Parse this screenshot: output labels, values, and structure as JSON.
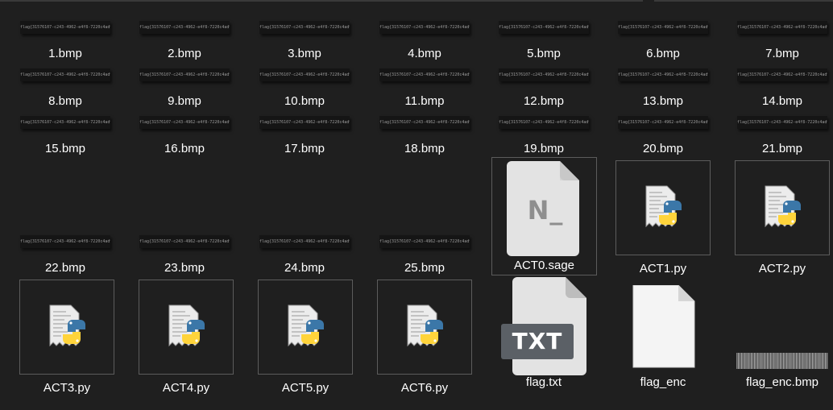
{
  "strip_text": "flag{31576107-c243-4962-e4f8-7220c4ad9a76}",
  "files": [
    {
      "name": "1.bmp"
    },
    {
      "name": "2.bmp"
    },
    {
      "name": "3.bmp"
    },
    {
      "name": "4.bmp"
    },
    {
      "name": "5.bmp"
    },
    {
      "name": "6.bmp"
    },
    {
      "name": "7.bmp"
    },
    {
      "name": "8.bmp"
    },
    {
      "name": "9.bmp"
    },
    {
      "name": "10.bmp"
    },
    {
      "name": "11.bmp"
    },
    {
      "name": "12.bmp"
    },
    {
      "name": "13.bmp"
    },
    {
      "name": "14.bmp"
    },
    {
      "name": "15.bmp"
    },
    {
      "name": "16.bmp"
    },
    {
      "name": "17.bmp"
    },
    {
      "name": "18.bmp"
    },
    {
      "name": "19.bmp"
    },
    {
      "name": "20.bmp"
    },
    {
      "name": "21.bmp"
    },
    {
      "name": "22.bmp"
    },
    {
      "name": "23.bmp"
    },
    {
      "name": "24.bmp"
    },
    {
      "name": "25.bmp"
    },
    {
      "name": "ACT0.sage"
    },
    {
      "name": "ACT1.py"
    },
    {
      "name": "ACT2.py"
    },
    {
      "name": "ACT3.py"
    },
    {
      "name": "ACT4.py"
    },
    {
      "name": "ACT5.py"
    },
    {
      "name": "ACT6.py"
    },
    {
      "name": "flag.txt"
    },
    {
      "name": "flag_enc"
    },
    {
      "name": "flag_enc.bmp"
    }
  ],
  "icons": {
    "sage_glyph": "N_",
    "txt_badge": "TXT"
  },
  "colors": {
    "background": "#1f1f1f",
    "tile_border": "#5c5c5c",
    "python_blue": "#3b77a8",
    "python_yellow": "#ffd43b"
  }
}
